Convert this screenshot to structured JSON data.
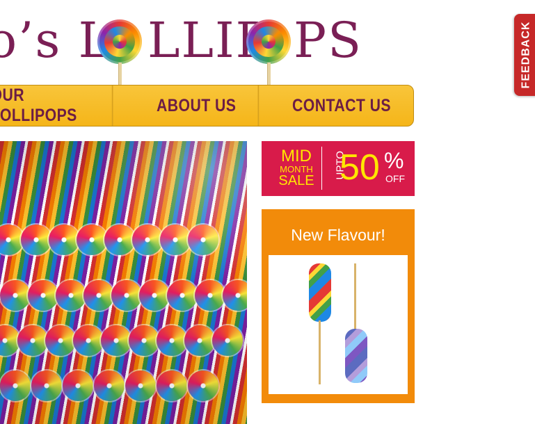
{
  "logo": {
    "part1": "o’s L",
    "part2": "LLIP",
    "part3": "PS"
  },
  "nav": {
    "items": [
      {
        "label": "OUR LOLLIPOPS"
      },
      {
        "label": "ABOUT US"
      },
      {
        "label": "CONTACT US"
      }
    ]
  },
  "sale_banner": {
    "mid": "MID",
    "month": "MONTH",
    "sale": "SALE",
    "upto": "UPTO",
    "number": "50",
    "percent": "%",
    "off": "OFF",
    "colors": {
      "background": "#d81b4a",
      "accent": "#ffe600"
    }
  },
  "new_flavour": {
    "title": "New Flavour!"
  },
  "feedback": {
    "label": "FEEDBACK"
  },
  "colors": {
    "brand_purple": "#7a1f55",
    "nav_yellow": "#f5b519",
    "flavour_orange": "#f28b0a",
    "feedback_red": "#c62828"
  }
}
